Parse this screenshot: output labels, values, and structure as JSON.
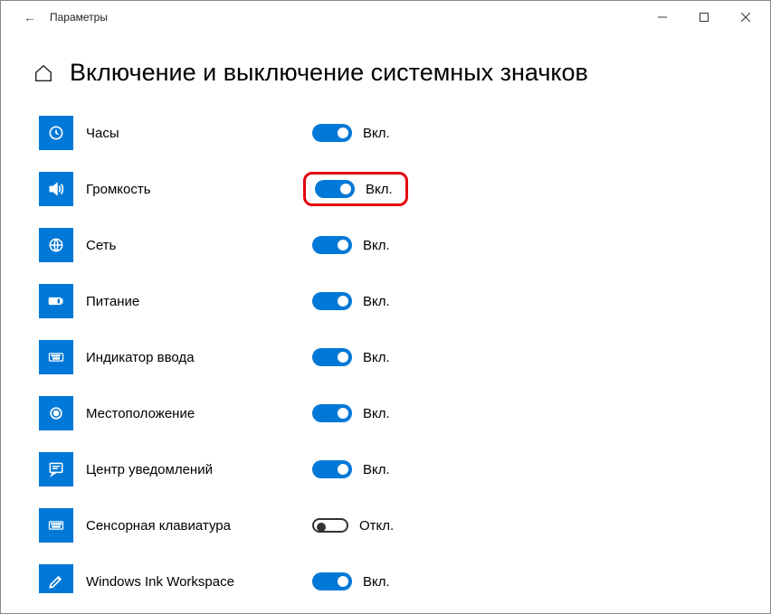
{
  "window": {
    "title": "Параметры"
  },
  "page": {
    "heading": "Включение и выключение системных значков"
  },
  "states": {
    "on": "Вкл.",
    "off": "Откл."
  },
  "items": [
    {
      "icon": "clock",
      "label": "Часы",
      "on": true,
      "hl": false
    },
    {
      "icon": "volume",
      "label": "Громкость",
      "on": true,
      "hl": true
    },
    {
      "icon": "network",
      "label": "Сеть",
      "on": true,
      "hl": false
    },
    {
      "icon": "power",
      "label": "Питание",
      "on": true,
      "hl": false
    },
    {
      "icon": "input",
      "label": "Индикатор ввода",
      "on": true,
      "hl": false
    },
    {
      "icon": "location",
      "label": "Местоположение",
      "on": true,
      "hl": false
    },
    {
      "icon": "action",
      "label": "Центр уведомлений",
      "on": true,
      "hl": false
    },
    {
      "icon": "keyboard",
      "label": "Сенсорная клавиатура",
      "on": false,
      "hl": false
    },
    {
      "icon": "ink",
      "label": "Windows Ink Workspace",
      "on": true,
      "hl": false
    }
  ]
}
